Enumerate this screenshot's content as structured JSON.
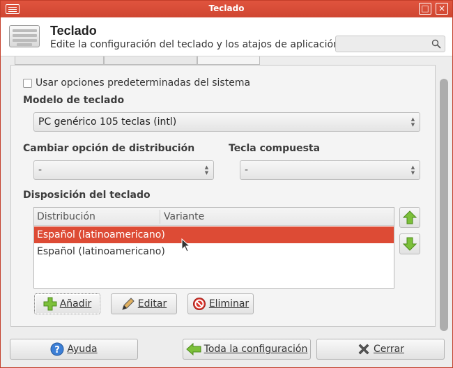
{
  "window": {
    "title": "Teclado"
  },
  "header": {
    "title": "Teclado",
    "subtitle": "Edite la configuración del teclado y los atajos de aplicación"
  },
  "options": {
    "use_system_defaults_label": "Usar opciones predeterminadas del sistema",
    "use_system_defaults_checked": false
  },
  "model": {
    "label": "Modelo de teclado",
    "value": "PC genérico 105 teclas (intl)"
  },
  "layout_switch": {
    "label": "Cambiar opción de distribución",
    "value": "-"
  },
  "compose_key": {
    "label": "Tecla compuesta",
    "value": "-"
  },
  "layouts": {
    "label": "Disposición del teclado",
    "columns": [
      "Distribución",
      "Variante"
    ],
    "rows": [
      {
        "layout": "Español (latinoamericano)",
        "variant": "",
        "selected": true
      },
      {
        "layout": "Español (latinoamericano)",
        "variant": "",
        "selected": false
      }
    ],
    "add_label": "Añadir",
    "edit_label": "Editar",
    "remove_label": "Eliminar"
  },
  "footer": {
    "help_label": "Ayuda",
    "all_settings_label": "Toda la configuración",
    "close_label": "Cerrar"
  },
  "colors": {
    "accent": "#dd4b35",
    "titlebar": "#d44b35"
  }
}
